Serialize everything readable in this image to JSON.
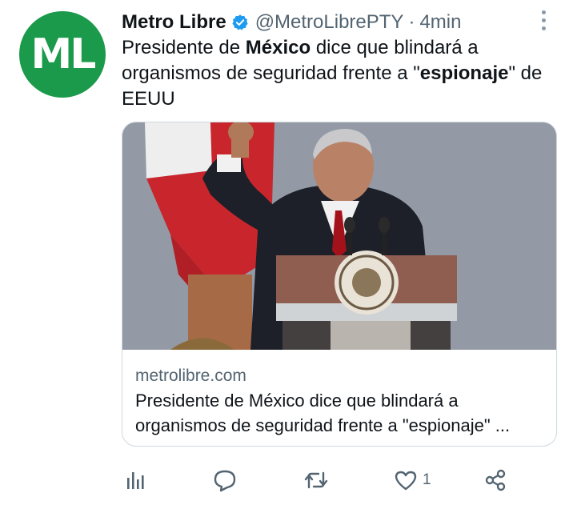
{
  "avatar": {
    "initials": "ML",
    "color": "#1a9a4a"
  },
  "header": {
    "name": "Metro Libre",
    "handle": "@MetroLibrePTY",
    "separator": "·",
    "time": "4min"
  },
  "tweet": {
    "text_parts": [
      "Presidente de ",
      "México",
      " dice que blindará a organismos de seguridad frente a \"",
      "espionaje",
      "\" de EEUU"
    ]
  },
  "card": {
    "domain": "metrolibre.com",
    "title": "Presidente de México dice que blindará a organismos de seguridad frente a \"espionaje\" ...",
    "image_icon": "podium-speaker-photo"
  },
  "actions": {
    "analytics_icon": "analytics-icon",
    "reply_icon": "reply-icon",
    "retweet_icon": "retweet-icon",
    "like_icon": "like-icon",
    "like_count": "1",
    "share_icon": "share-icon"
  },
  "colors": {
    "verified": "#1d9bf0",
    "secondary_text": "#536471",
    "border": "#cfd9de"
  }
}
